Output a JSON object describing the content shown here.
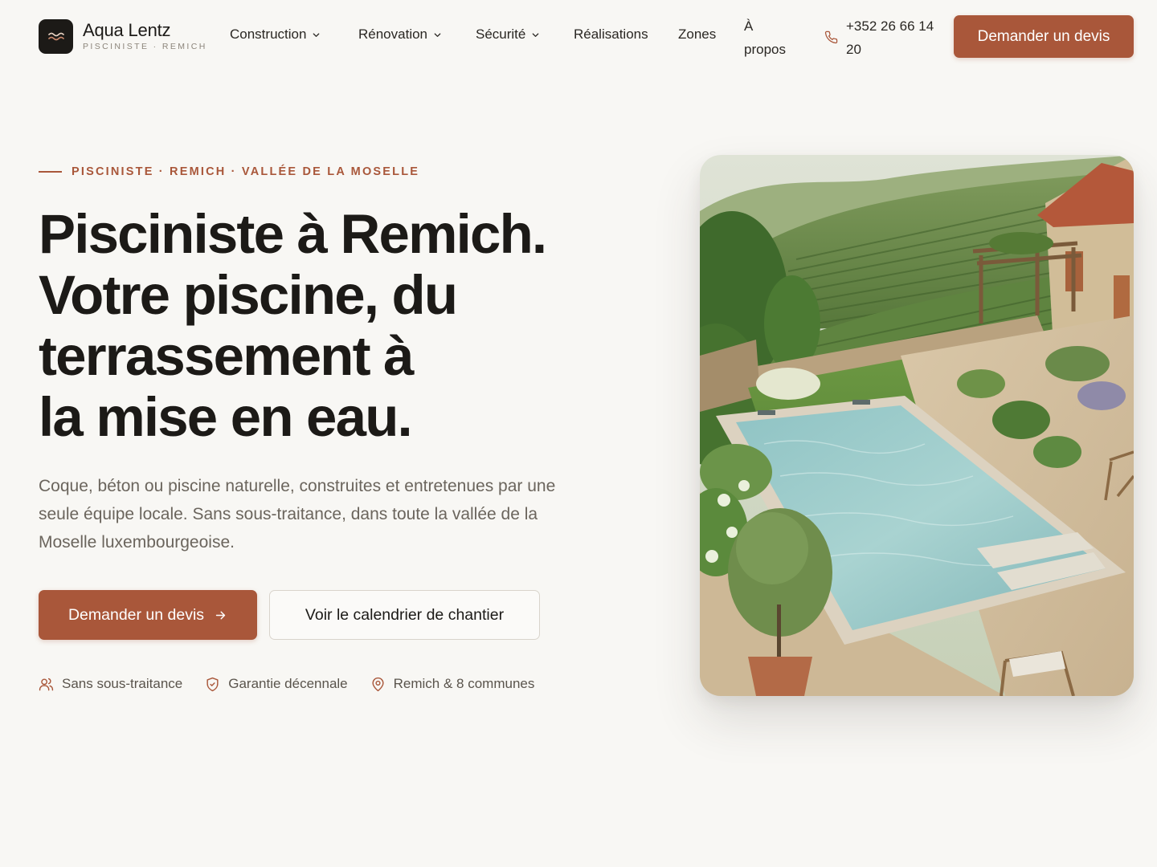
{
  "brand": {
    "name": "Aqua Lentz",
    "tagline": "PISCINISTE · REMICH"
  },
  "nav": {
    "items": [
      {
        "label": "Construction",
        "dropdown": true
      },
      {
        "label": "Rénovation",
        "dropdown": true
      },
      {
        "label": "Sécurité",
        "dropdown": true
      },
      {
        "label": "Réalisations",
        "dropdown": false
      },
      {
        "label": "Zones",
        "dropdown": false
      }
    ],
    "about_label": "À propos",
    "phone": "+352 26 66 14 20",
    "cta_label": "Demander un devis"
  },
  "hero": {
    "eyebrow": "PISCINISTE · REMICH · VALLÉE DE LA MOSELLE",
    "title_lines": [
      "Pisciniste à Remich.",
      "Votre piscine, du",
      "terrassement à",
      "la mise en eau."
    ],
    "lead": "Coque, béton ou piscine naturelle, construites et entretenues par une seule équipe locale. Sans sous-traitance, dans toute la vallée de la Moselle luxembourgeoise.",
    "primary_cta": "Demander un devis",
    "secondary_cta": "Voir le calendrier de chantier",
    "features": [
      {
        "icon": "users-icon",
        "label": "Sans sous-traitance"
      },
      {
        "icon": "shield-check-icon",
        "label": "Garantie décennale"
      },
      {
        "icon": "map-pin-icon",
        "label": "Remich & 8 communes"
      }
    ]
  },
  "colors": {
    "accent": "#a9573a",
    "background": "#f8f7f4",
    "text": "#1c1a17",
    "muted": "#6b655d"
  }
}
